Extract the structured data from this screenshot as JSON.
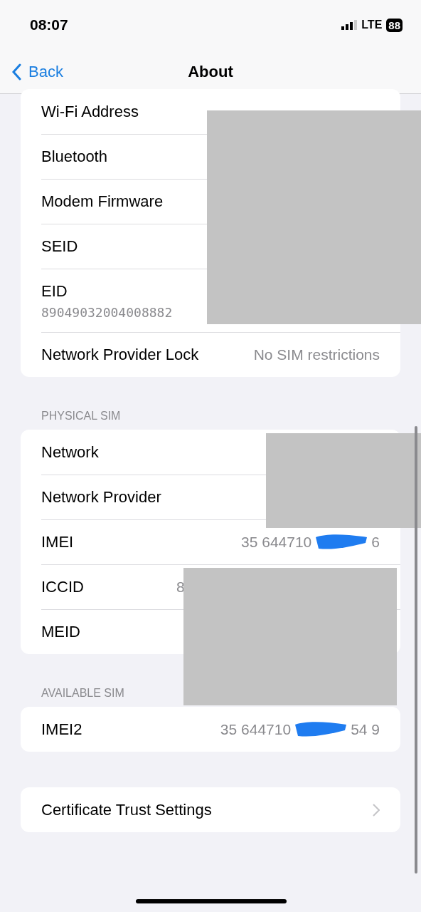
{
  "status_bar": {
    "time": "08:07",
    "network": "LTE",
    "battery": "88"
  },
  "nav": {
    "back": "Back",
    "title": "About"
  },
  "sections": [
    {
      "rows": [
        {
          "kind": "inline",
          "label": "Wi-Fi Address"
        },
        {
          "kind": "inline",
          "label": "Bluetooth"
        },
        {
          "kind": "inline",
          "label": "Modem Firmware"
        },
        {
          "kind": "inline",
          "label": "SEID"
        },
        {
          "kind": "stacked",
          "label": "EID",
          "value": "89049032004008882"
        },
        {
          "kind": "inline",
          "label": "Network Provider Lock",
          "value": "No SIM restrictions"
        }
      ]
    },
    {
      "header": "PHYSICAL SIM",
      "rows": [
        {
          "kind": "inline",
          "label": "Network"
        },
        {
          "kind": "inline",
          "label": "Network Provider"
        },
        {
          "kind": "scribbled",
          "label": "IMEI",
          "value": "35 644710",
          "value_end": "6"
        },
        {
          "kind": "partial",
          "label": "ICCID",
          "value": "8"
        },
        {
          "kind": "inline",
          "label": "MEID"
        }
      ]
    },
    {
      "header": "AVAILABLE SIM",
      "rows": [
        {
          "kind": "scribbled",
          "label": "IMEI2",
          "value": "35 644710",
          "value_end": "54 9"
        }
      ]
    },
    {
      "rows": [
        {
          "kind": "link",
          "label": "Certificate Trust Settings"
        }
      ]
    }
  ]
}
